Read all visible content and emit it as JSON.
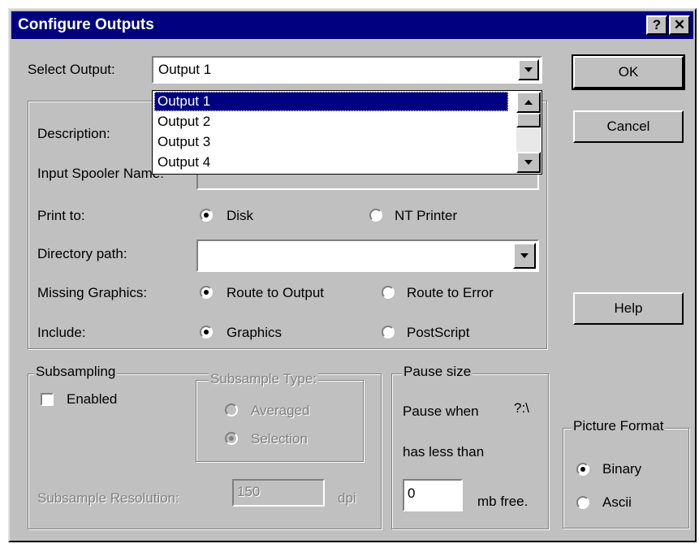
{
  "window": {
    "title": "Configure Outputs",
    "help_btn": "?",
    "close_btn": "✕"
  },
  "select_output": {
    "label": "Select Output:",
    "value": "Output 1",
    "options": [
      "Output 1",
      "Output 2",
      "Output 3",
      "Output 4"
    ]
  },
  "buttons": {
    "ok": "OK",
    "cancel": "Cancel",
    "help": "Help"
  },
  "form": {
    "description_label": "Description:",
    "spooler_label": "Input Spooler Name:",
    "print_to_label": "Print to:",
    "print_disk": "Disk",
    "print_nt": "NT Printer",
    "directory_label": "Directory path:",
    "directory_value": "",
    "missing_label": "Missing Graphics:",
    "missing_route_output": "Route to Output",
    "missing_route_error": "Route to Error",
    "include_label": "Include:",
    "include_graphics": "Graphics",
    "include_postscript": "PostScript"
  },
  "subsampling": {
    "legend": "Subsampling",
    "enabled_label": "Enabled",
    "type_legend": "Subsample Type:",
    "averaged": "Averaged",
    "selection": "Selection",
    "resolution_label": "Subsample Resolution:",
    "resolution_value": "150",
    "unit": "dpi"
  },
  "pause": {
    "legend": "Pause size",
    "line1": "Pause when",
    "drive": "?:\\",
    "line2": "has less than",
    "value": "0",
    "unit": "mb free."
  },
  "picture_format": {
    "legend": "Picture Format",
    "binary": "Binary",
    "ascii": "Ascii"
  }
}
